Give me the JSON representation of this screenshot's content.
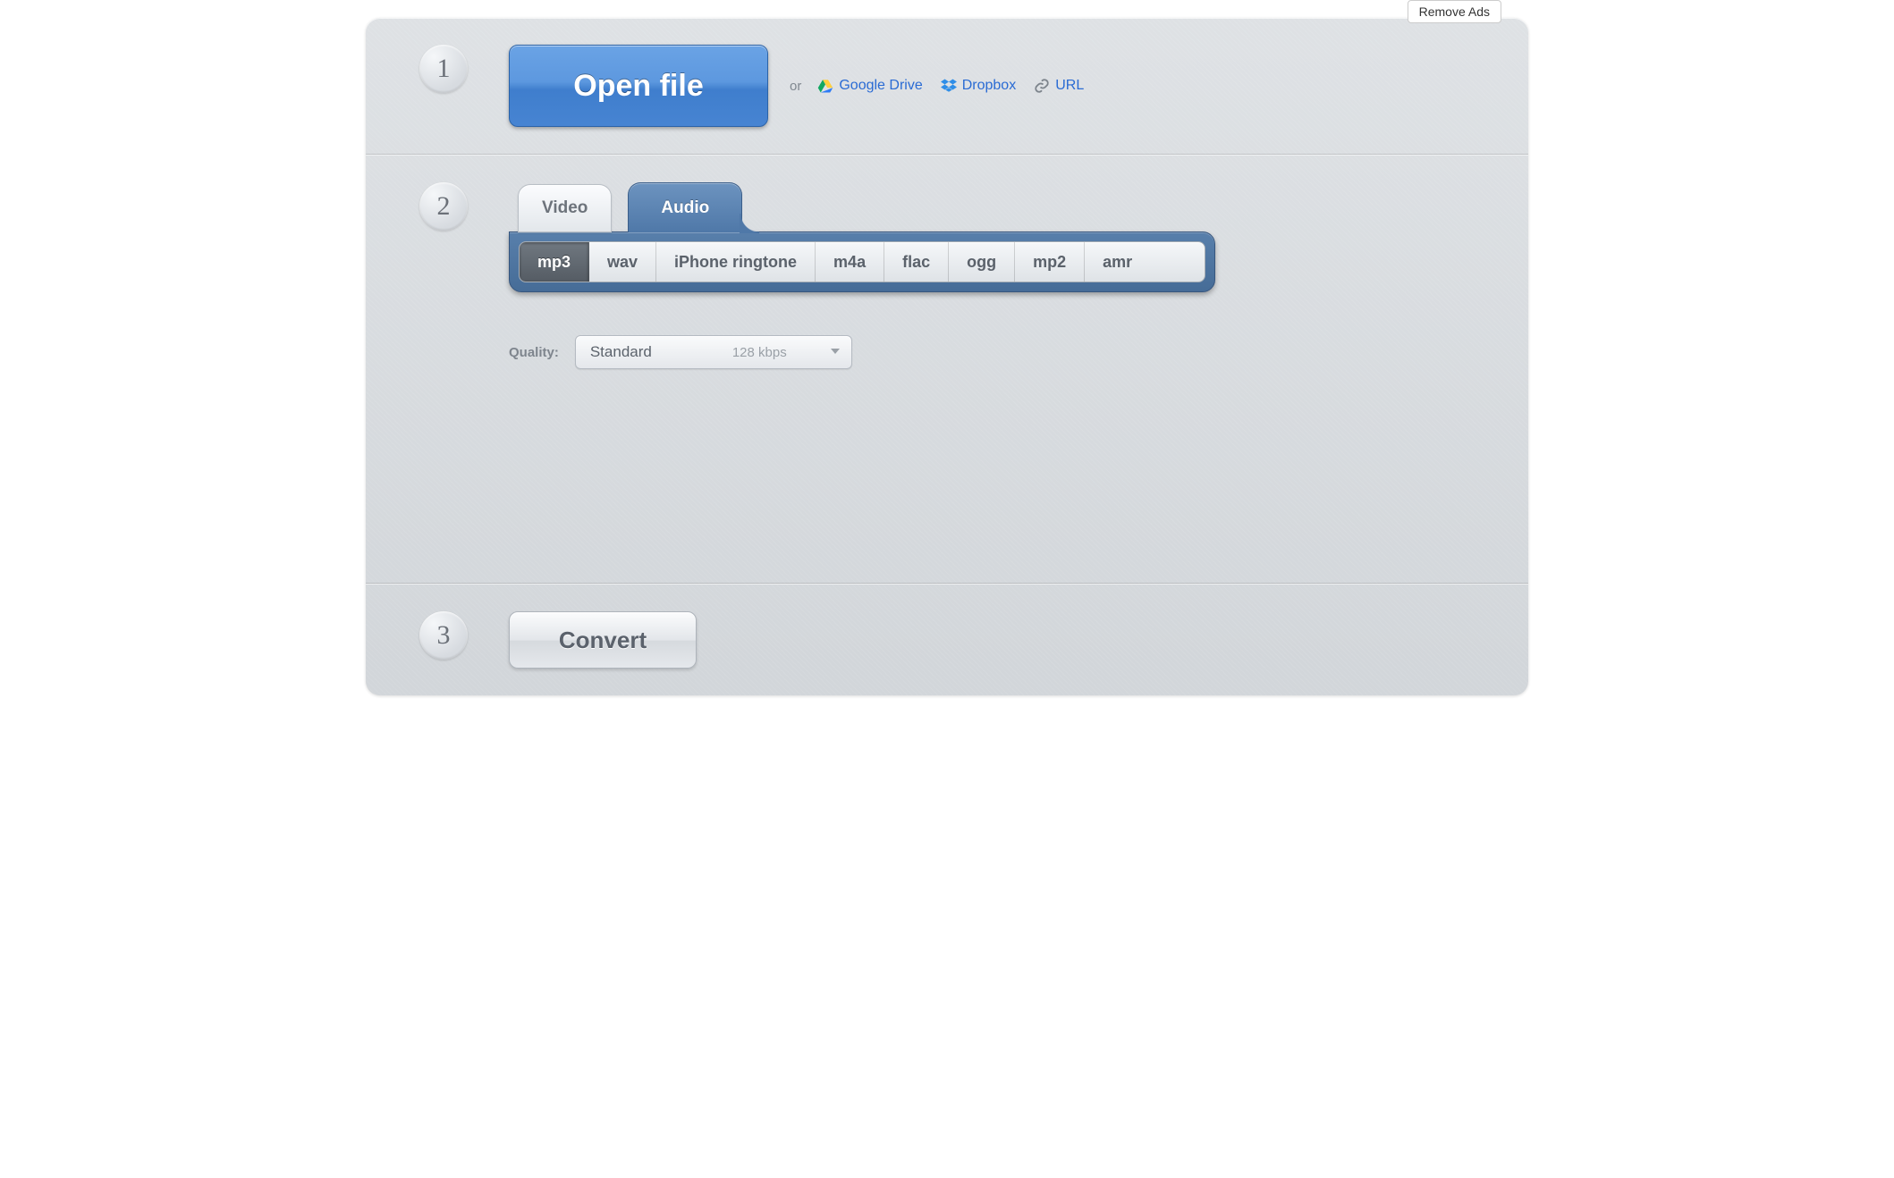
{
  "remove_ads_label": "Remove Ads",
  "steps": {
    "one": "1",
    "two": "2",
    "three": "3"
  },
  "step1": {
    "open_file_label": "Open file",
    "or_label": "or",
    "google_drive_label": "Google Drive",
    "dropbox_label": "Dropbox",
    "url_label": "URL"
  },
  "step2": {
    "tabs": {
      "video": "Video",
      "audio": "Audio"
    },
    "active_tab": "audio",
    "formats": [
      "mp3",
      "wav",
      "iPhone ringtone",
      "m4a",
      "flac",
      "ogg",
      "mp2",
      "amr"
    ],
    "active_format": "mp3",
    "quality_label": "Quality:",
    "quality": {
      "name": "Standard",
      "bitrate": "128 kbps"
    }
  },
  "step3": {
    "convert_label": "Convert"
  }
}
